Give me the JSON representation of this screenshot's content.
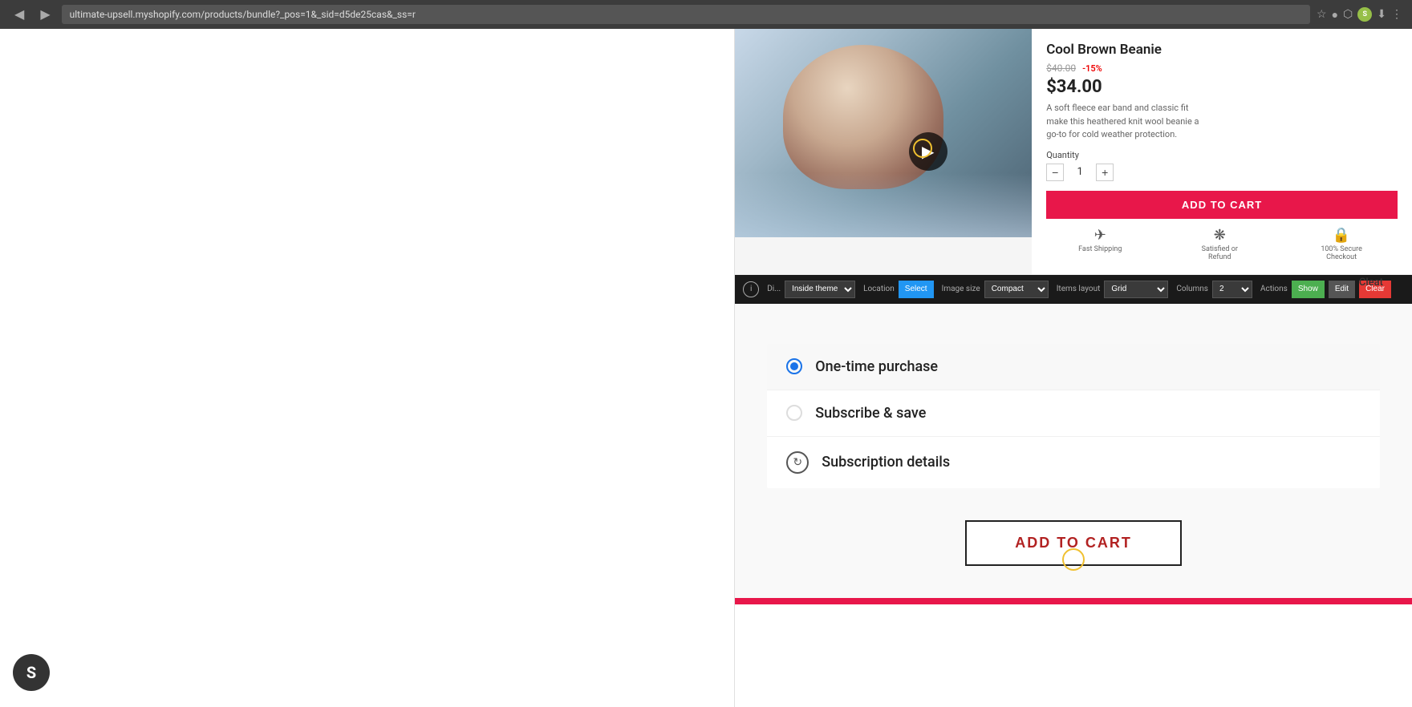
{
  "browser": {
    "url": "ultimate-upsell.myshopify.com/products/bundle?_pos=1&_sid=d5de25cas&_ss=r",
    "back_label": "◀",
    "forward_label": "▶"
  },
  "product": {
    "title": "Cool Brown Beanie",
    "price_original": "$40.00",
    "discount_label": "-15%",
    "price_current": "$34.00",
    "description": "A soft fleece ear band and classic fit make this heathered knit wool beanie a go-to for cold weather protection.",
    "quantity_label": "Quantity",
    "quantity_value": "1",
    "add_to_cart_label": "ADD TO CART",
    "trust_badges": [
      {
        "icon": "✈",
        "label": "Fast Shipping"
      },
      {
        "icon": "❋",
        "label": "Satisfied or Refund"
      },
      {
        "icon": "🔒",
        "label": "100% Secure Checkout"
      }
    ]
  },
  "toolbar": {
    "display_label": "Di...",
    "location_label": "Location",
    "image_size_label": "Image size",
    "items_layout_label": "Items layout",
    "columns_label": "Columns",
    "actions_label": "Actions",
    "display_option": "Inside theme",
    "location_option": "Select",
    "image_size_option": "Compact",
    "items_layout_option": "Grid",
    "columns_option": "2",
    "btn_show": "Show",
    "btn_edit": "Edit",
    "btn_clear": "Clear"
  },
  "purchase_options": {
    "one_time_label": "One-time purchase",
    "subscribe_label": "Subscribe & save",
    "subscription_details_label": "Subscription details"
  },
  "main_cta": {
    "label": "ADD TO CART"
  },
  "cleat_label": "Cleat",
  "shopify_icon": "S"
}
